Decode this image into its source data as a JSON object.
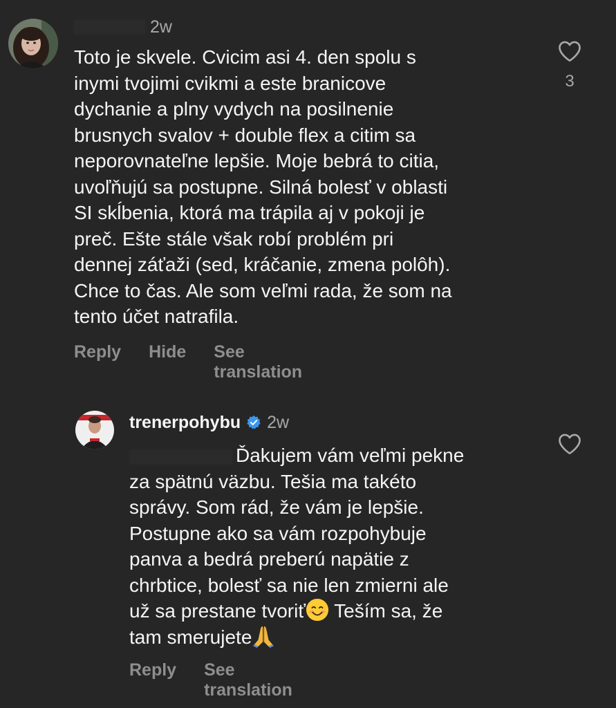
{
  "comment1": {
    "time": "2w",
    "text": "Toto je skvele. Cvicim asi 4. den spolu s\ninymi tvojimi cvikmi a este branicove\ndychanie a plny vydych na posilnenie\nbrusnych svalov + double flex a citim sa\nneporovnateľne lepšie. Moje bebrá to citia,\nuvoľňujú sa postupne. Silná bolesť v oblasti\nSI skĺbenia, ktorá ma trápila aj v pokoji je\npreč. Ešte stále však robí problém pri\ndennej záťaži (sed, kráčanie, zmena polôh).\nChce to čas. Ale som veľmi rada, že som na\ntento účet natrafila.",
    "like_count": "3",
    "actions": {
      "reply": "Reply",
      "hide": "Hide",
      "see_translation": "See translation"
    }
  },
  "comment2": {
    "username": "trenerpohybu",
    "time": "2w",
    "text_part1": "Ďakujem vám veľmi pekne\nza spätnú väzbu. Tešia ma takéto\nsprávy. Som rád, že vám je lepšie.\nPostupne ako sa vám rozpohybuje\npanva a bedrá preberú napätie z\nchrbtice, bolesť sa nie len zmierni ale\nuž sa prestane tvoriť",
    "text_part2": " Teším sa, že\ntam smerujete",
    "actions": {
      "reply": "Reply",
      "see_translation": "See translation"
    }
  },
  "icons": {
    "like": "heart-outline-icon",
    "verified": "verified-badge-icon",
    "smile": "smiling-face-emoji",
    "pray": "folded-hands-emoji"
  },
  "colors": {
    "background": "#262626",
    "text": "#f5f5f5",
    "secondary": "#a8a8a8",
    "action": "#8e8e8e",
    "verified": "#3897f0"
  }
}
